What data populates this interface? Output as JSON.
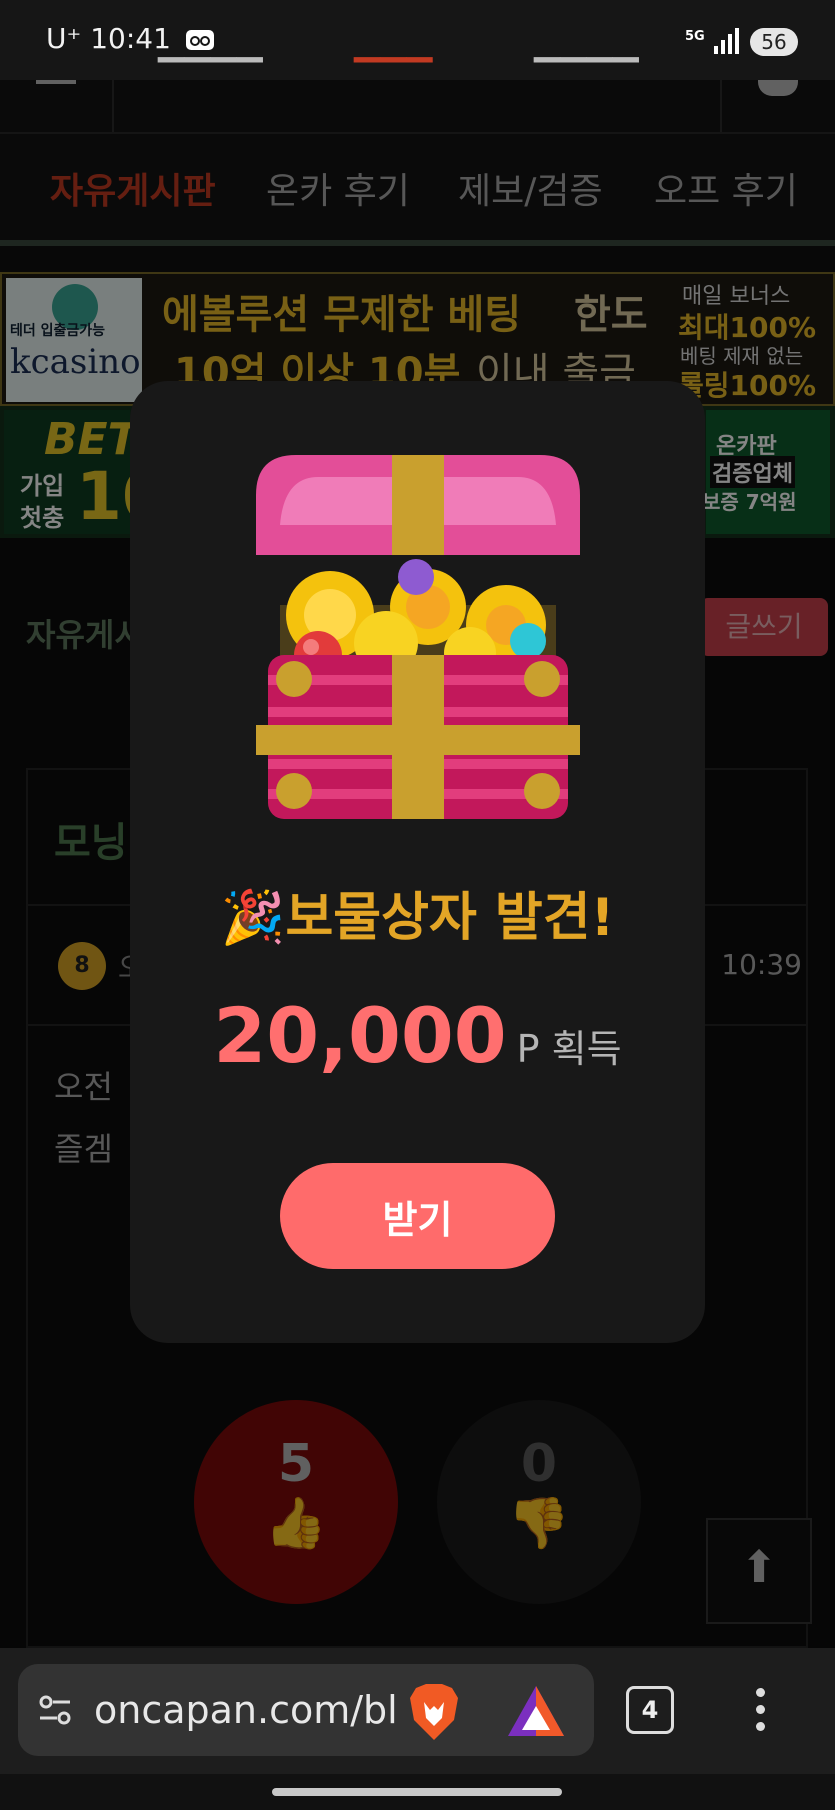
{
  "status": {
    "carrier": "U⁺",
    "time": "10:41",
    "network": "5G",
    "battery": "56"
  },
  "board_tabs": [
    {
      "label": "자유게시판",
      "active": true
    },
    {
      "label": "온카 후기",
      "active": false
    },
    {
      "label": "제보/검증",
      "active": false
    },
    {
      "label": "오프 후기",
      "active": false
    }
  ],
  "banner_top": {
    "badge": "테더 입출금가능",
    "logo": "kcasino",
    "line1_a": "에볼루션 무제한 베팅",
    "line1_b": "한도",
    "line2_a": "10억 이상 10분",
    "line2_b": "이내 출금",
    "side1": "매일 보너스",
    "side2": "최대100%",
    "side3": "베팅 제재 없는",
    "side4": "롤링100%"
  },
  "banner_second": {
    "left_brand": "BET",
    "left_sub1": "가입",
    "left_sub2": "첫충",
    "left_num": "10",
    "right1": "온카판",
    "right2": "검증업체",
    "right3": "보증 7억원"
  },
  "page": {
    "title": "자유게시",
    "write_label": "글쓰기"
  },
  "post": {
    "title": "모닝",
    "level": "8",
    "nick": "오",
    "time": "10:39",
    "body_line1": "오전",
    "body_line2": "즐겜"
  },
  "votes": {
    "up": "5",
    "down": "0"
  },
  "modal": {
    "emoji": "🎉",
    "heading": "보물상자 발견!",
    "points": "20,000",
    "unit": "P 획득",
    "button": "받기"
  },
  "browser": {
    "url": "oncapan.com/bl",
    "tab_count": "4"
  },
  "icons": {
    "menu": "hamburger-icon",
    "bell": "bell-icon",
    "tune": "site-settings-icon",
    "brave": "brave-lion-icon",
    "rewards": "brave-rewards-icon",
    "kebab": "more-vert-icon",
    "thumb_up": "thumbs-up-icon",
    "thumb_down": "thumbs-down-icon",
    "scroll_top": "arrow-up-icon"
  },
  "colors": {
    "accent_red": "#c23a22",
    "points_red": "#ff6f6f",
    "button": "#ff6b6b",
    "heading_gold": "#e3a526",
    "modal_bg": "#181818"
  }
}
